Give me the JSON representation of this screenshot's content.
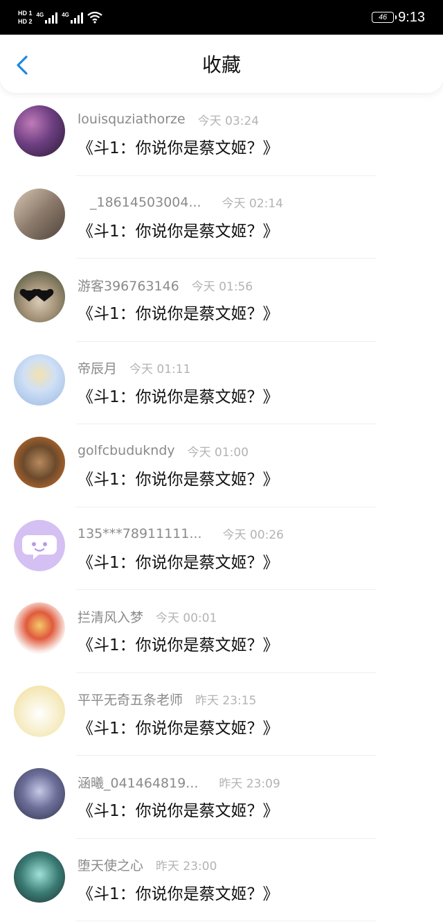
{
  "status_bar": {
    "hd1": "HD 1",
    "hd2": "HD 2",
    "net1": "4G",
    "net2": "4G",
    "battery": "46",
    "time": "9:13"
  },
  "header": {
    "title": "收藏"
  },
  "items": [
    {
      "user": "louisquziathorze",
      "time": "今天 03:24",
      "message": "《斗1：你说你是蔡文姬？》",
      "avatar_color": "#5a3a6e"
    },
    {
      "user": "_18614503004...",
      "time": "今天 02:14",
      "message": "《斗1：你说你是蔡文姬？》",
      "avatar_color": "#8c7b6c"
    },
    {
      "user": "游客396763146",
      "time": "今天 01:56",
      "message": "《斗1：你说你是蔡文姬？》",
      "avatar_color": "#3e4a32"
    },
    {
      "user": "帝辰月",
      "time": "今天 01:11",
      "message": "《斗1：你说你是蔡文姬？》",
      "avatar_color": "#c9d8ef"
    },
    {
      "user": "golfcbudukndy",
      "time": "今天 01:00",
      "message": "《斗1：你说你是蔡文姬？》",
      "avatar_color": "#6b4a2c"
    },
    {
      "user": "135***78911111...",
      "time": "今天 00:26",
      "message": "《斗1：你说你是蔡文姬？》",
      "avatar_color": "#c9b3ef"
    },
    {
      "user": "拦清风入梦",
      "time": "今天 00:01",
      "message": "《斗1：你说你是蔡文姬？》",
      "avatar_color": "#f3e6e2"
    },
    {
      "user": "平平无奇五条老师",
      "time": "昨天 23:15",
      "message": "《斗1：你说你是蔡文姬？》",
      "avatar_color": "#f6ecc4"
    },
    {
      "user": "涵曦_041464819...",
      "time": "昨天 23:09",
      "message": "《斗1：你说你是蔡文姬？》",
      "avatar_color": "#4a4d6a"
    },
    {
      "user": "堕天使之心",
      "time": "昨天 23:00",
      "message": "《斗1：你说你是蔡文姬？》",
      "avatar_color": "#3a7a74"
    }
  ]
}
